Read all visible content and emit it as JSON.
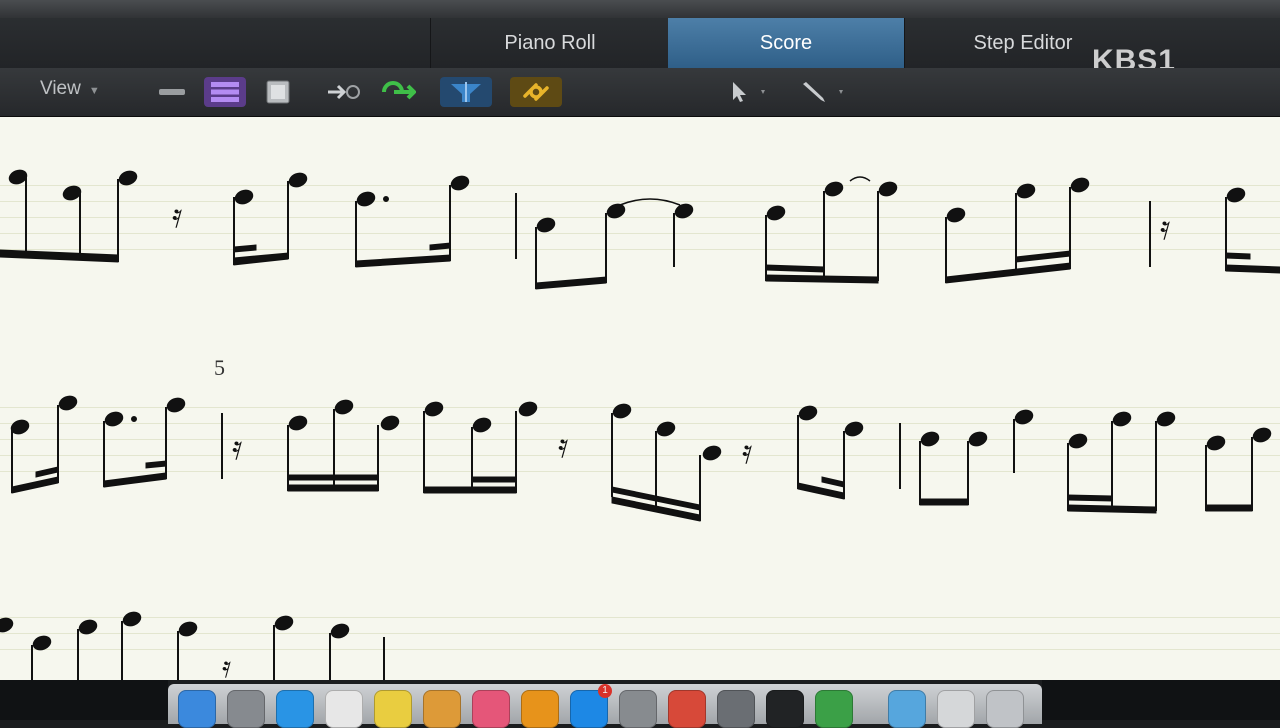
{
  "tabs": [
    {
      "label": "Piano Roll",
      "active": false
    },
    {
      "label": "Score",
      "active": true
    },
    {
      "label": "Step Editor",
      "active": false
    }
  ],
  "watermark": "KBS1",
  "toolbar": {
    "view_label": "View",
    "buttons": [
      {
        "name": "collapse-icon",
        "color": "#9a9da0"
      },
      {
        "name": "layout-purple-icon",
        "color": "#8c5bd6"
      },
      {
        "name": "page-view-icon",
        "color": "#b9bcbf"
      },
      {
        "name": "midi-out-icon",
        "color": "#cfd2d5"
      },
      {
        "name": "catch-green-icon",
        "color": "#3fbf48"
      },
      {
        "name": "filter-blue-icon",
        "color": "#3b85c9"
      },
      {
        "name": "link-yellow-icon",
        "color": "#d9a91d"
      },
      {
        "name": "pointer-tool-icon",
        "color": "#c8cbce"
      },
      {
        "name": "pencil-tool-icon",
        "color": "#c8cbce"
      }
    ]
  },
  "score": {
    "measure_number": "5",
    "colors": {
      "paper": "#f6f7ee",
      "note": "#111111",
      "staff": "#e3e6cf"
    }
  },
  "dock": {
    "icons": [
      {
        "name": "finder-icon",
        "color": "#3d8fe8"
      },
      {
        "name": "launchpad-icon",
        "color": "#8c9096"
      },
      {
        "name": "safari-icon",
        "color": "#2a9bf0"
      },
      {
        "name": "calendar-icon",
        "color": "#f2f2f2"
      },
      {
        "name": "notes-icon",
        "color": "#f5d742"
      },
      {
        "name": "photos-icon",
        "color": "#e8a13a"
      },
      {
        "name": "itunes-icon",
        "color": "#f05a7e"
      },
      {
        "name": "ibooks-icon",
        "color": "#f29a1b"
      },
      {
        "name": "app-store-icon",
        "color": "#1e8ef0"
      },
      {
        "name": "system-preferences-icon",
        "color": "#8d9196"
      },
      {
        "name": "chrome-icon",
        "color": "#e24c3b"
      },
      {
        "name": "preview-icon",
        "color": "#6f7378"
      },
      {
        "name": "terminal-icon",
        "color": "#222426"
      },
      {
        "name": "activity-monitor-icon",
        "color": "#3da84a"
      },
      {
        "name": "folder-icon",
        "color": "#5aaee8"
      },
      {
        "name": "downloads-icon",
        "color": "#e0e2e4"
      },
      {
        "name": "trash-icon",
        "color": "#c9ccd0"
      }
    ],
    "badge": "1"
  }
}
